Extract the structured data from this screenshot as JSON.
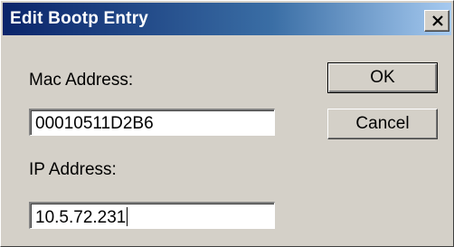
{
  "window": {
    "title": "Edit Bootp Entry",
    "close_icon": "close-x-icon"
  },
  "form": {
    "mac_label": "Mac Address:",
    "mac_value": "00010511D2B6",
    "ip_label": "IP Address:",
    "ip_value": "10.5.72.231"
  },
  "buttons": {
    "ok_label": "OK",
    "cancel_label": "Cancel"
  },
  "colors": {
    "titlebar_start": "#0a246a",
    "titlebar_end": "#a6caf0",
    "dialog_face": "#d4d0c8"
  }
}
